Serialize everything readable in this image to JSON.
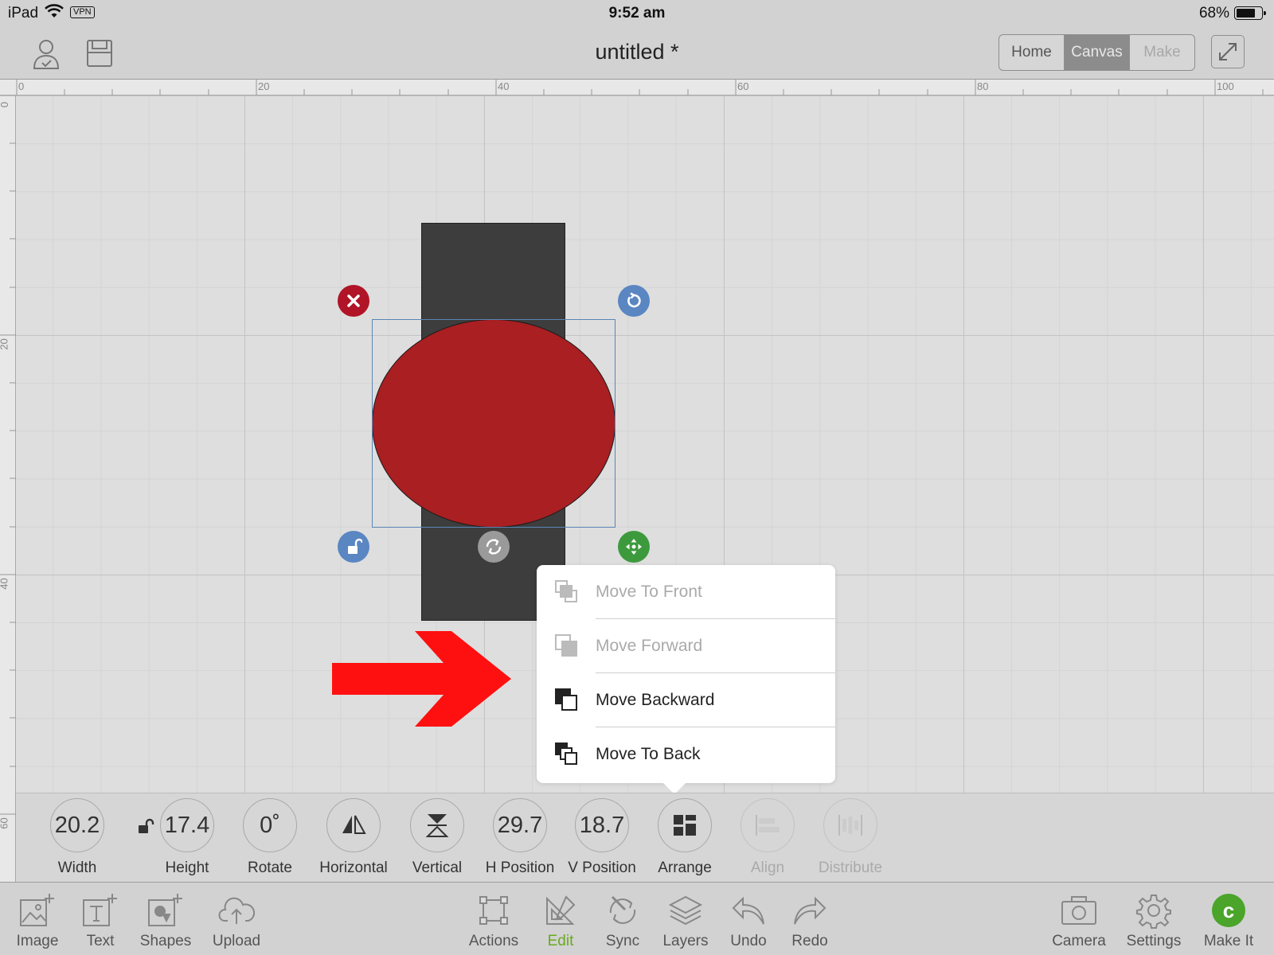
{
  "status_bar": {
    "device": "iPad",
    "vpn": "VPN",
    "time": "9:52 am",
    "battery": "68%"
  },
  "header": {
    "title": "untitled *",
    "tabs": [
      {
        "label": "Home",
        "state": "normal"
      },
      {
        "label": "Canvas",
        "state": "active"
      },
      {
        "label": "Make",
        "state": "disabled"
      }
    ]
  },
  "rulers": {
    "top_labels": [
      "0",
      "20",
      "40",
      "60",
      "80",
      "100"
    ],
    "left_labels": [
      "0",
      "20",
      "40",
      "60"
    ]
  },
  "canvas": {
    "shapes": [
      {
        "type": "rectangle",
        "fill": "#3d3d3d"
      },
      {
        "type": "ellipse",
        "fill": "#a91f22",
        "selected": true
      }
    ],
    "annotation_arrow_color": "#ff1010"
  },
  "arrange_menu": {
    "items": [
      {
        "label": "Move To Front",
        "enabled": false,
        "icon": "move-to-front-icon"
      },
      {
        "label": "Move Forward",
        "enabled": false,
        "icon": "move-forward-icon"
      },
      {
        "label": "Move Backward",
        "enabled": true,
        "icon": "move-backward-icon"
      },
      {
        "label": "Move To Back",
        "enabled": true,
        "icon": "move-to-back-icon"
      }
    ]
  },
  "properties": {
    "width": {
      "value": "20.2",
      "label": "Width"
    },
    "height": {
      "value": "17.4",
      "label": "Height"
    },
    "rotate": {
      "value": "0˚",
      "label": "Rotate"
    },
    "horizontal": {
      "label": "Horizontal",
      "icon": "flip-horizontal-icon"
    },
    "vertical": {
      "label": "Vertical",
      "icon": "flip-vertical-icon"
    },
    "h_position": {
      "value": "29.7",
      "label": "H Position"
    },
    "v_position": {
      "value": "18.7",
      "label": "V Position"
    },
    "arrange": {
      "label": "Arrange",
      "icon": "arrange-icon"
    },
    "align": {
      "label": "Align",
      "icon": "align-icon",
      "enabled": false
    },
    "distribute": {
      "label": "Distribute",
      "icon": "distribute-icon",
      "enabled": false
    }
  },
  "bottom_toolbar": {
    "left": [
      {
        "label": "Image",
        "icon": "image-icon"
      },
      {
        "label": "Text",
        "icon": "text-icon"
      },
      {
        "label": "Shapes",
        "icon": "shapes-icon"
      },
      {
        "label": "Upload",
        "icon": "upload-icon"
      }
    ],
    "center": [
      {
        "label": "Actions",
        "icon": "actions-icon"
      },
      {
        "label": "Edit",
        "icon": "edit-icon",
        "active": true
      },
      {
        "label": "Sync",
        "icon": "sync-icon"
      },
      {
        "label": "Layers",
        "icon": "layers-icon"
      },
      {
        "label": "Undo",
        "icon": "undo-icon"
      },
      {
        "label": "Redo",
        "icon": "redo-icon"
      }
    ],
    "right": [
      {
        "label": "Camera",
        "icon": "camera-icon"
      },
      {
        "label": "Settings",
        "icon": "settings-icon"
      },
      {
        "label": "Make It",
        "icon": "make-it-icon"
      }
    ],
    "active_color": "#6aaa1e"
  }
}
